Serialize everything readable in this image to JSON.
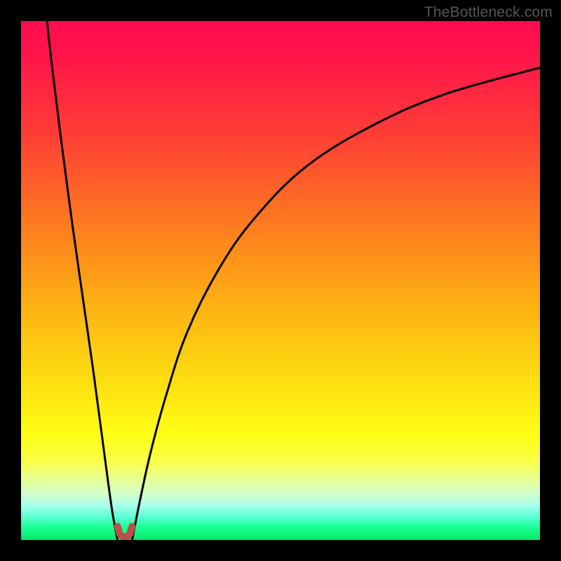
{
  "watermark": {
    "text": "TheBottleneck.com"
  },
  "colors": {
    "black": "#000000",
    "curve": "#000000",
    "marker": "#bb4f49",
    "gradient_stops": [
      {
        "pct": 0,
        "color": "#ff0b4f"
      },
      {
        "pct": 8,
        "color": "#ff1848"
      },
      {
        "pct": 22,
        "color": "#fe3e35"
      },
      {
        "pct": 40,
        "color": "#fd7e1e"
      },
      {
        "pct": 55,
        "color": "#fdb213"
      },
      {
        "pct": 70,
        "color": "#fde010"
      },
      {
        "pct": 80,
        "color": "#feff15"
      },
      {
        "pct": 85,
        "color": "#f8ff4a"
      },
      {
        "pct": 88,
        "color": "#eaff8e"
      },
      {
        "pct": 91,
        "color": "#d3ffc9"
      },
      {
        "pct": 93.5,
        "color": "#a3ffea"
      },
      {
        "pct": 95.5,
        "color": "#5cffd3"
      },
      {
        "pct": 97.5,
        "color": "#1cff97"
      },
      {
        "pct": 100,
        "color": "#05e866"
      }
    ]
  },
  "chart_data": {
    "type": "line",
    "title": "",
    "xlabel": "",
    "ylabel": "",
    "xlim": [
      0,
      100
    ],
    "ylim": [
      0,
      100
    ],
    "annotations": [
      "watermark: TheBottleneck.com"
    ],
    "series": [
      {
        "name": "left-branch",
        "x": [
          5,
          6,
          8,
          10,
          12,
          14,
          16,
          17.5,
          18.6
        ],
        "y": [
          100,
          91,
          75,
          60,
          46,
          32,
          17,
          6,
          0
        ]
      },
      {
        "name": "right-branch",
        "x": [
          21.4,
          23,
          25,
          28,
          32,
          38,
          45,
          55,
          68,
          82,
          100
        ],
        "y": [
          0,
          8,
          17,
          28,
          40,
          52,
          62,
          72,
          80,
          86,
          91
        ]
      },
      {
        "name": "minimum-marker",
        "x": [
          18.6,
          19.0,
          19.6,
          20.0,
          20.4,
          21.0,
          21.4
        ],
        "y": [
          2.6,
          1.2,
          0.6,
          0.6,
          0.6,
          1.2,
          2.6
        ]
      }
    ],
    "optimal_x_pct": 20
  }
}
